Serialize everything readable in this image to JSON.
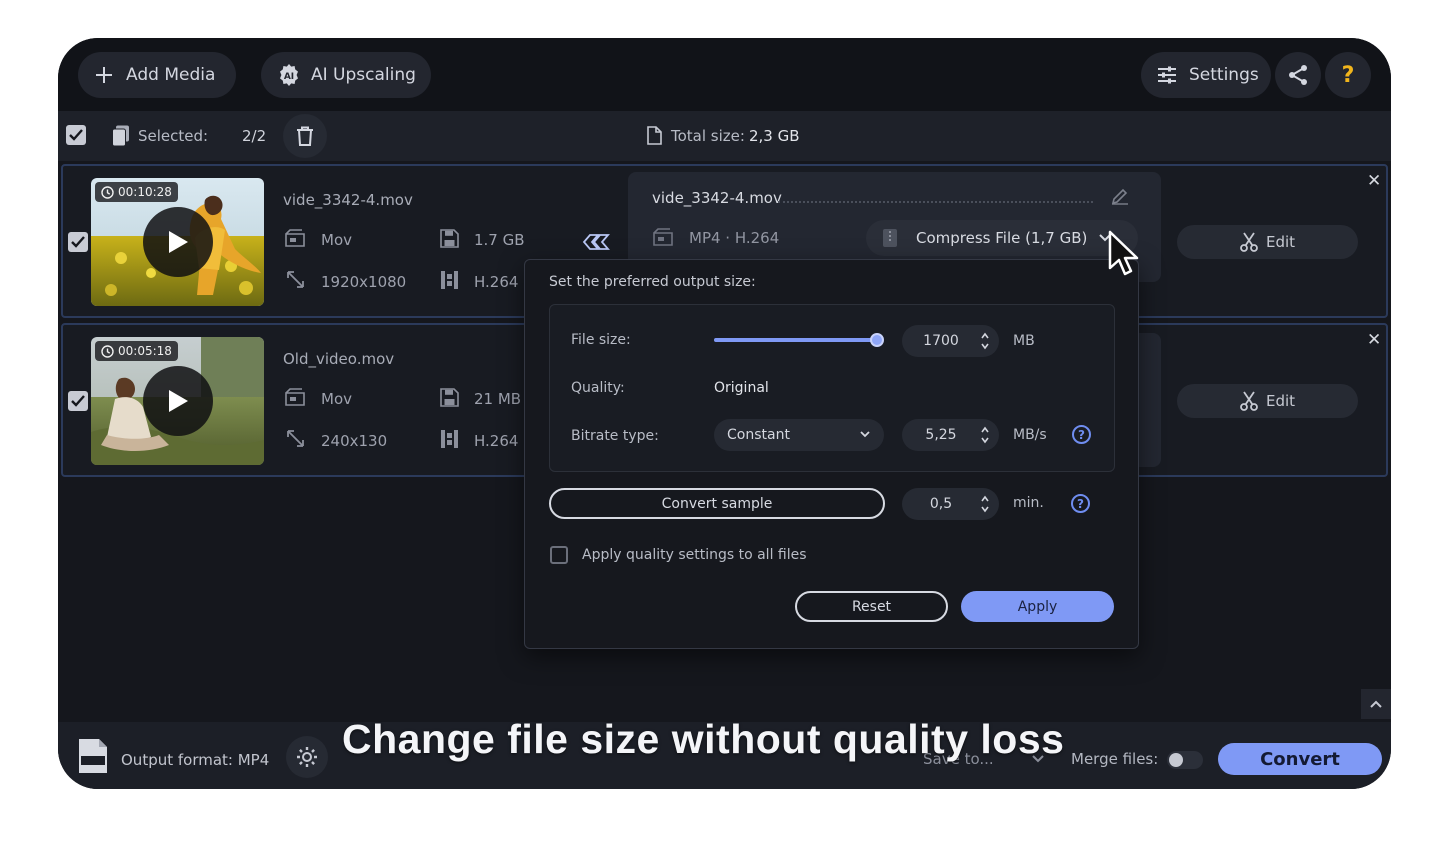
{
  "toolbar": {
    "add_media_label": "Add Media",
    "ai_upscaling_label": "AI Upscaling",
    "settings_label": "Settings"
  },
  "selection": {
    "selected_label": "Selected:",
    "selected_count": "2/2",
    "total_size_label": "Total size:",
    "total_size_value": "2,3 GB"
  },
  "files": [
    {
      "duration": "00:10:28",
      "name": "vide_3342-4.mov",
      "format": "Mov",
      "size": "1.7 GB",
      "resolution": "1920x1080",
      "codec": "H.264",
      "edit_label": "Edit",
      "checked": true
    },
    {
      "duration": "00:05:18",
      "name": "Old_video.mov",
      "format": "Mov",
      "size": "21 MB",
      "resolution": "240x130",
      "codec": "H.264",
      "edit_label": "Edit",
      "checked": true
    }
  ],
  "output": {
    "name": "vide_3342-4.mov",
    "format": "MP4 · H.264",
    "compress_label": "Compress File (1,7 GB)"
  },
  "popup": {
    "title": "Set the preferred output size:",
    "file_size_label": "File size:",
    "file_size_value": "1700",
    "file_size_unit": "MB",
    "file_size_slider_fraction": 0.97,
    "quality_label": "Quality:",
    "quality_value": "Original",
    "bitrate_type_label": "Bitrate type:",
    "bitrate_type_value": "Constant",
    "bitrate_value": "5,25",
    "bitrate_unit": "MB/s",
    "convert_sample_label": "Convert sample",
    "sample_value": "0,5",
    "sample_unit": "min.",
    "apply_all_label": "Apply quality settings to all files",
    "apply_all_checked": false,
    "reset_label": "Reset",
    "apply_label": "Apply"
  },
  "bottom": {
    "output_format_label": "Output format: MP4",
    "save_to_label": "Save to...",
    "merge_files_label": "Merge files:",
    "convert_label": "Convert"
  },
  "caption": "Change file size without quality loss",
  "colors": {
    "accent": "#7f99f5",
    "background": "#15171d",
    "help_accent": "#6f8df0"
  }
}
